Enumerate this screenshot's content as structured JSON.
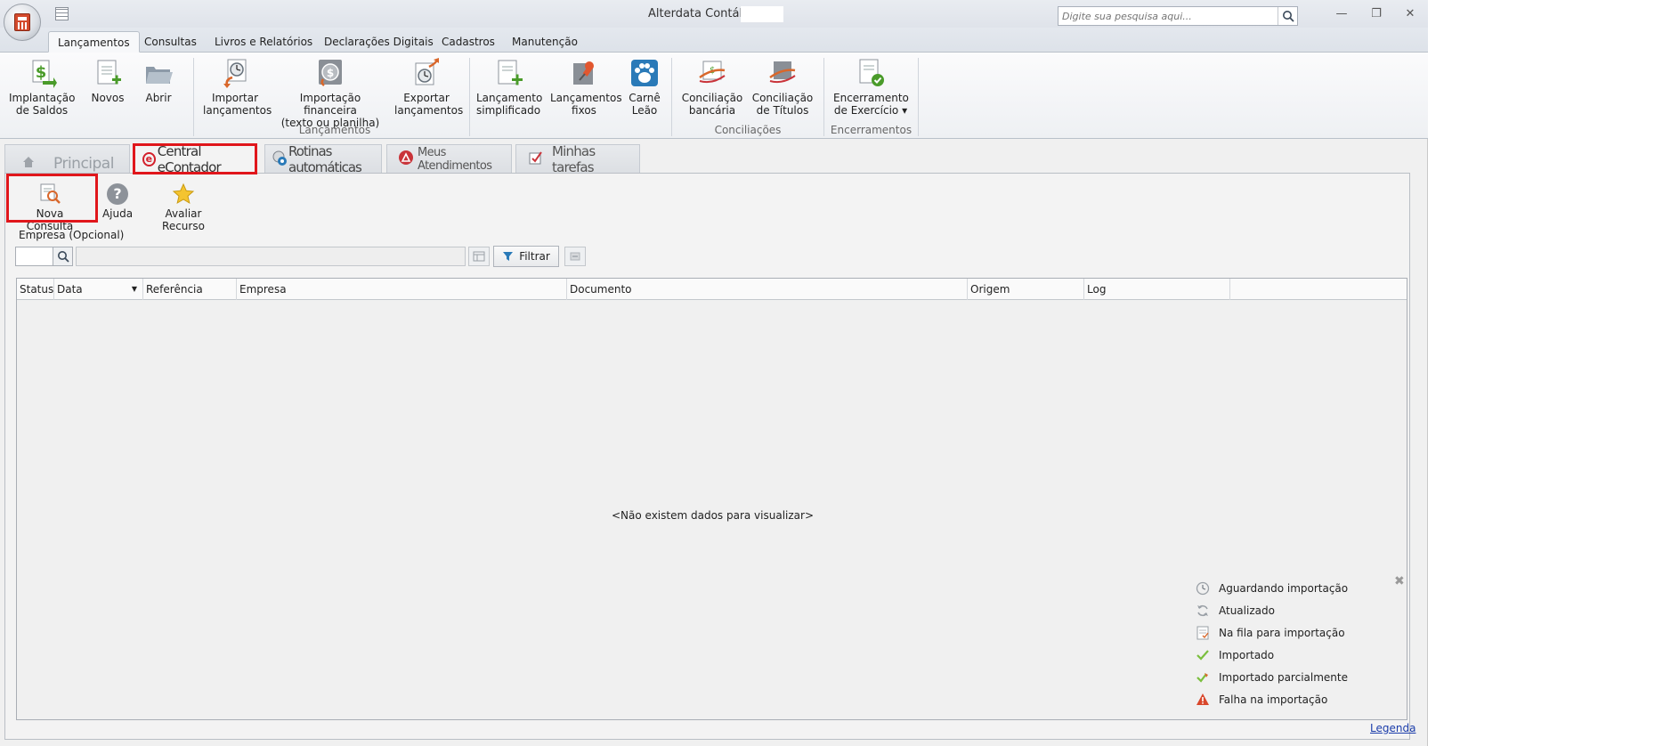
{
  "window": {
    "title": "Alterdata Contábil -",
    "search_placeholder": "Digite sua pesquisa aqui...",
    "minimize_glyph": "—",
    "restore_glyph": "❐",
    "close_glyph": "✕"
  },
  "ribbon_tabs": [
    {
      "label": "Lançamentos",
      "active": true
    },
    {
      "label": "Consultas"
    },
    {
      "label": "Livros e Relatórios"
    },
    {
      "label": "Declarações Digitais"
    },
    {
      "label": "Cadastros"
    },
    {
      "label": "Manutenção"
    }
  ],
  "ribbon": {
    "buttons": [
      {
        "line1": "Implantação",
        "line2": "de Saldos",
        "icon": "dollar-arrow-icon"
      },
      {
        "line1": "Novos",
        "line2": "",
        "icon": "new-document-icon"
      },
      {
        "line1": "Abrir",
        "line2": "",
        "icon": "open-folder-icon"
      },
      {
        "line1": "Importar",
        "line2": "lançamentos",
        "icon": "import-clock-icon"
      },
      {
        "line1": "Importação financeira",
        "line2": "(texto ou planilha)",
        "icon": "financial-import-icon"
      },
      {
        "line1": "Exportar",
        "line2": "lançamentos",
        "icon": "export-clock-icon"
      },
      {
        "line1": "Lançamento",
        "line2": "simplificado",
        "icon": "simplified-entry-icon"
      },
      {
        "line1": "Lançamentos",
        "line2": "fixos",
        "icon": "pin-icon"
      },
      {
        "line1": "Carnê",
        "line2": "Leão",
        "icon": "paw-icon"
      },
      {
        "line1": "Conciliação",
        "line2": "bancária",
        "icon": "bank-reconciliation-icon"
      },
      {
        "line1": "Conciliação",
        "line2": "de Títulos",
        "icon": "title-reconciliation-icon"
      },
      {
        "line1": "Encerramento",
        "line2": "de Exercício ▾",
        "icon": "closing-check-icon"
      }
    ],
    "groups": [
      "Lançamentos",
      "Conciliações",
      "Encerramentos"
    ]
  },
  "doc_tabs": [
    {
      "label": "Principal"
    },
    {
      "label": "Central eContador",
      "active": true
    },
    {
      "label": "Rotinas automáticas"
    },
    {
      "label": "Meus Atendimentos"
    },
    {
      "label": "Minhas tarefas"
    }
  ],
  "toolbar": {
    "new_query": "Nova Consulta",
    "help": "Ajuda",
    "rate": "Avaliar Recurso"
  },
  "filter": {
    "company_label": "Empresa (Opcional)",
    "code_value": "",
    "name_value": "",
    "filter_button": "Filtrar"
  },
  "grid": {
    "columns": [
      "Status",
      "Data",
      "Referência",
      "Empresa",
      "Documento",
      "Origem",
      "Log"
    ],
    "empty_message": "<Não existem dados para visualizar>"
  },
  "legend": {
    "items": [
      {
        "label": "Aguardando importação",
        "icon": "clock-icon"
      },
      {
        "label": "Atualizado",
        "icon": "refresh-icon"
      },
      {
        "label": "Na fila para importação",
        "icon": "queue-icon"
      },
      {
        "label": "Importado",
        "icon": "check-icon"
      },
      {
        "label": "Importado parcialmente",
        "icon": "partial-check-icon"
      },
      {
        "label": "Falha na importação",
        "icon": "warning-icon"
      }
    ],
    "close_glyph": "✖",
    "link": "Legenda"
  },
  "colors": {
    "highlight": "#e0161b",
    "accent_orange": "#d9672b",
    "accent_blue": "#2a7ab8"
  }
}
